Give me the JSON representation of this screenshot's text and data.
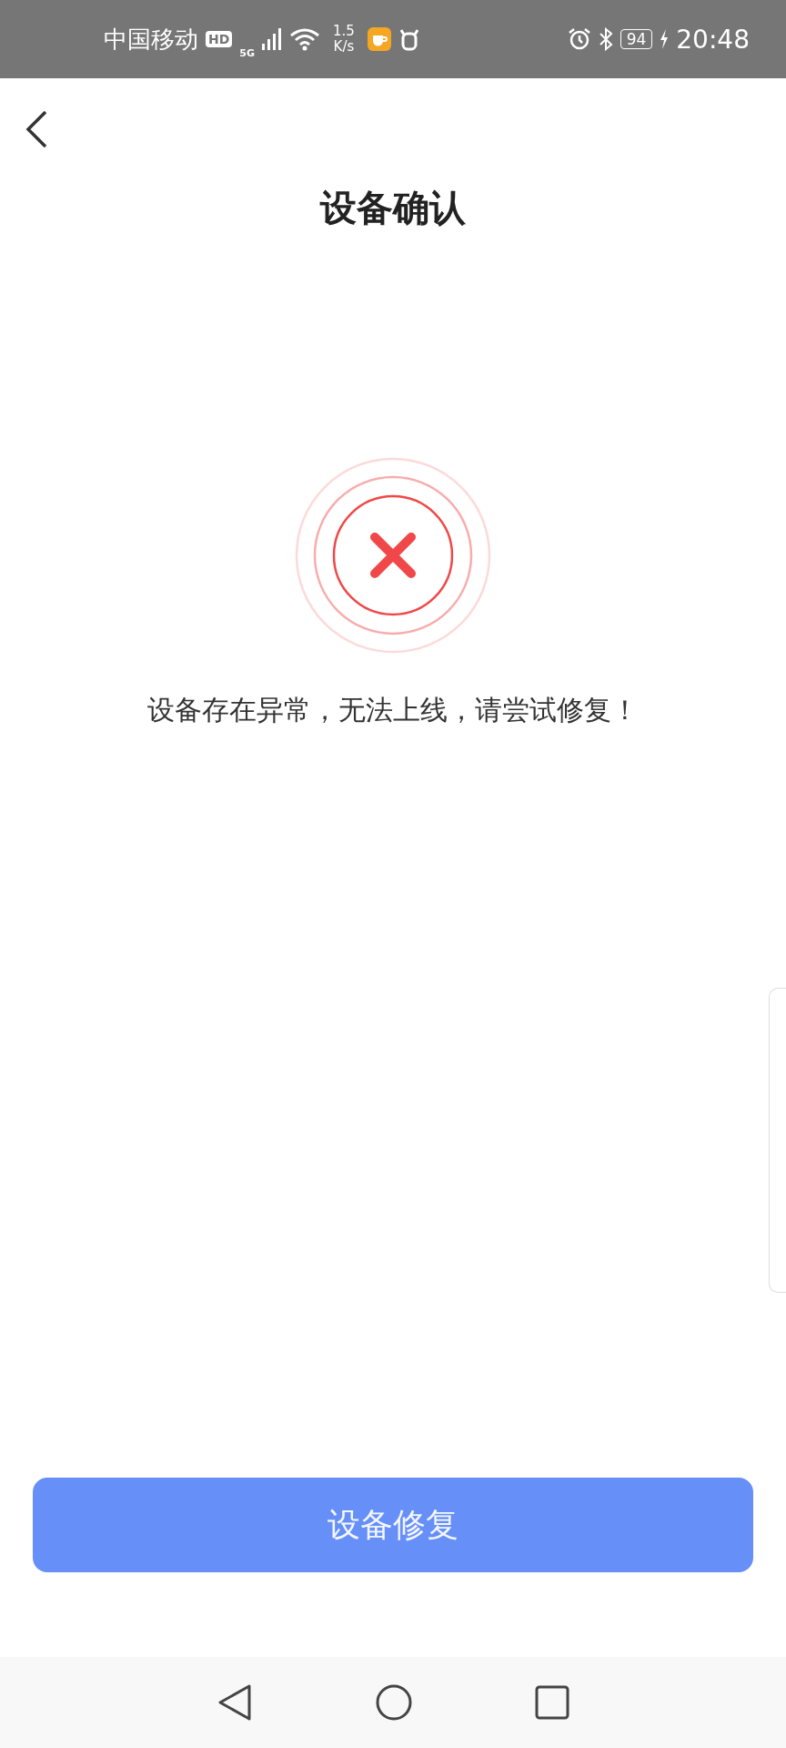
{
  "status_bar": {
    "carrier": "中国移动",
    "hd_badge": "HD",
    "network": "5G",
    "speed_value": "1.5",
    "speed_unit": "K/s",
    "battery": "94",
    "time": "20:48"
  },
  "header": {
    "title": "设备确认"
  },
  "result": {
    "kind": "error",
    "message": "设备存在异常，无法上线，请尝试修复！"
  },
  "primary_button": {
    "label": "设备修复"
  }
}
